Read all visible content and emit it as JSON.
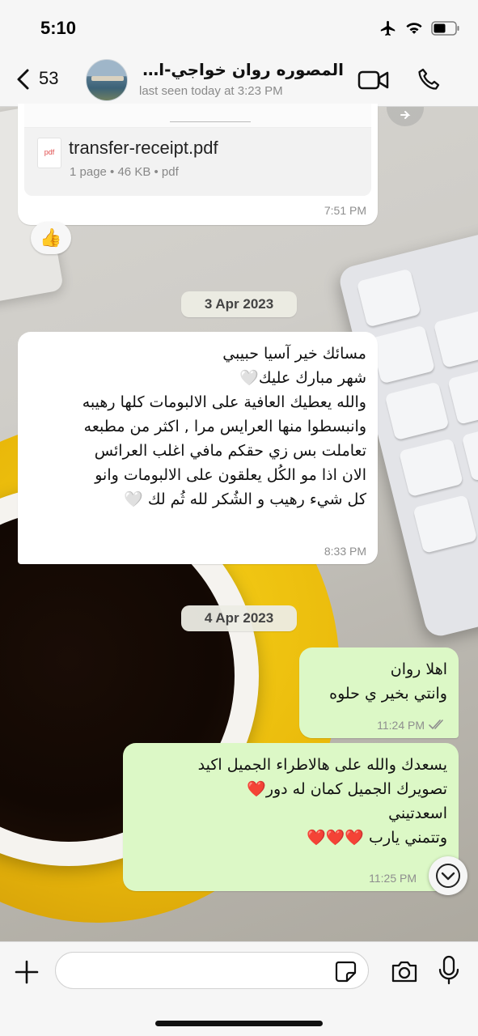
{
  "status_bar": {
    "time": "5:10",
    "icons": [
      "airplane-icon",
      "wifi-icon",
      "battery-icon"
    ]
  },
  "header": {
    "back_count": "53",
    "contact_name": "المصوره روان خواجي-الم...",
    "last_seen": "last seen today at 3:23 PM",
    "icons": [
      "chevron-left-icon",
      "video-call-icon",
      "phone-icon"
    ]
  },
  "messages": [
    {
      "type": "document",
      "direction": "incoming",
      "file_name": "transfer-receipt.pdf",
      "file_icon_label": "pdf",
      "meta": "1 page • 46 KB • pdf",
      "time": "7:51 PM",
      "reaction": "👍"
    },
    {
      "type": "date",
      "label": "3 Apr 2023"
    },
    {
      "type": "text",
      "direction": "incoming",
      "lines": [
        "مسائك خير آسيا حبيبي",
        "شهر مبارك عليك🤍",
        "والله يعطيك العافية على الالبومات كلها رهيبه",
        "وانبسطوا منها العرايس مرا , اكثر من مطبعه",
        "تعاملت بس زي حقكم مافي اغلب العرائس",
        "الان اذا مو الكُل يعلقون على الالبومات وانو",
        "كل شيء رهيب و الشُكر لله ثُم لك 🤍"
      ],
      "time": "8:33 PM"
    },
    {
      "type": "date",
      "label": "4 Apr 2023"
    },
    {
      "type": "text",
      "direction": "outgoing",
      "lines": [
        "اهلا روان",
        "وانتي بخير ي حلوه"
      ],
      "time": "11:24 PM",
      "status": "read"
    },
    {
      "type": "text",
      "direction": "outgoing",
      "lines": [
        "يسعدك والله على هالاطراء الجميل اكيد",
        "تصويرك الجميل كمان له دور❤️",
        "اسعدتيني",
        "وتتمني يارب ❤️❤️❤️"
      ],
      "time": "11:25 PM"
    }
  ],
  "input_bar": {
    "placeholder": "",
    "icons": [
      "plus-icon",
      "sticker-icon",
      "camera-icon",
      "mic-icon"
    ]
  },
  "colors": {
    "incoming_bubble": "#ffffff",
    "outgoing_bubble": "#dcf8c6",
    "read_tick": "#8e8e8e"
  }
}
